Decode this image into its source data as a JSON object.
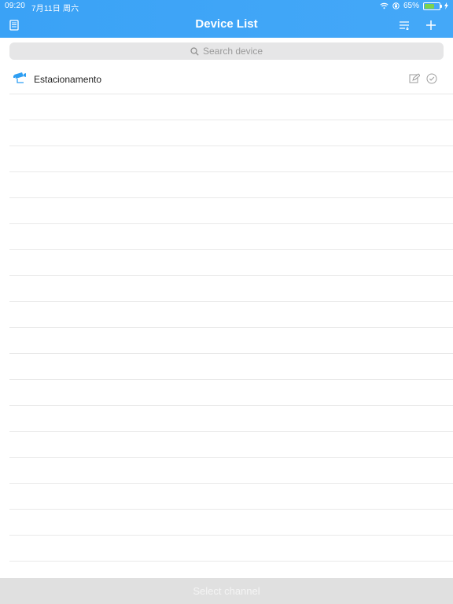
{
  "status_bar": {
    "time": "09:20",
    "date": "7月11日 周六",
    "battery": "65%",
    "battery_level": 0.65
  },
  "header": {
    "title": "Device List",
    "left_icon": "document-list-icon",
    "sort_icon": "sort-list-icon",
    "add_icon": "plus-icon"
  },
  "search": {
    "placeholder": "Search device"
  },
  "devices": [
    {
      "name": "Estacionamento",
      "icon": "camera-icon",
      "edit_icon": "edit-icon",
      "status_icon": "check-circle-icon"
    }
  ],
  "footer": {
    "label": "Select channel"
  },
  "colors": {
    "header_blue": "#3aa2f6",
    "camera_blue": "#2f9ff3",
    "footer_gray": "#e0e0e0"
  }
}
